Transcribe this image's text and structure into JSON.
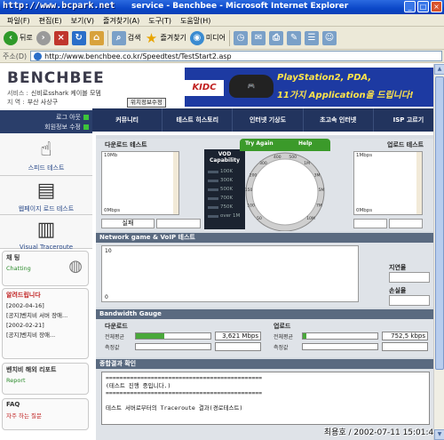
{
  "window": {
    "title_logo": "http://www.bcpark.net",
    "title": "service - Benchbee - Microsoft Internet Explorer",
    "min": "_",
    "max": "□",
    "close": "×"
  },
  "menu": [
    "파일(F)",
    "편집(E)",
    "보기(V)",
    "즐겨찾기(A)",
    "도구(T)",
    "도움말(H)"
  ],
  "toolbar": {
    "back": "뒤로",
    "search": "검색",
    "favorites": "즐겨찾기",
    "media": "미디어"
  },
  "address": {
    "label": "주소(D)",
    "url": "http://www.benchbee.co.kr/Speedtest/TestStart2.asp"
  },
  "header": {
    "logo": "BENCHBEE",
    "service_key": "서비스 :",
    "service_val": "신비로sshark 케이블 모뎀",
    "region_key": "지 역 :",
    "region_val": "부산 사상구",
    "loc_button": "위치정보수정"
  },
  "banner": {
    "kidc": "KIDC",
    "line1": "PlayStation2, PDA,",
    "line2": "11가지 Application을 드립니다!"
  },
  "login": {
    "logout": "로그 아웃",
    "member": "회원정보 수정"
  },
  "side_menu": [
    {
      "label": "스피드 테스트",
      "icon": "hand-pointer-icon"
    },
    {
      "label": "웹페이지 로드 테스트",
      "icon": "document-icon"
    },
    {
      "label": "Visual Traceroute",
      "icon": "graph-icon"
    }
  ],
  "chatting": {
    "title": "채 팅",
    "sub": "Chatting"
  },
  "notice": {
    "title": "알려드립니다",
    "items": [
      {
        "date": "[2002-04-16]",
        "text": "[공지]벤치비 서버 장애..."
      },
      {
        "date": "[2002-02-21]",
        "text": "[공지]벤치비 장애..."
      }
    ]
  },
  "report": {
    "title": "벤치비 해외 리포트",
    "sub": "Report"
  },
  "faq": {
    "title": "FAQ",
    "sub": "자주 하는 질문"
  },
  "nav": [
    "커뮤니티",
    "테스트 히스토리",
    "인터넷 기상도",
    "초고속 인터넷",
    "ISP 고르기"
  ],
  "speed": {
    "download_title": "다운로드 테스트",
    "upload_title": "업로드 테스트",
    "download_top": "10Mb",
    "download_bottom": "0Mbps",
    "upload_top": "1Mbps",
    "upload_bottom": "0Mbps",
    "download_status": "실패",
    "vod_title": "VOD Capability",
    "vod_levels": [
      "100K",
      "300K",
      "500K",
      "700K",
      "750K",
      "over 1M"
    ],
    "try_again": "Try Again",
    "help": "Help",
    "gauge_ticks": [
      "50",
      "100",
      "150",
      "200",
      "300",
      "400",
      "500",
      "1M",
      "3M",
      "5M",
      "7M",
      "10M"
    ]
  },
  "gamevoip": {
    "title": "Network game & VoIP 테스트",
    "axis_top": "10",
    "axis_bottom": "0",
    "latency_label": "지연율",
    "loss_label": "손실율"
  },
  "bandwidth": {
    "title": "Bandwidth Gauge",
    "download": {
      "title": "다운로드",
      "avg_label": "전체평균",
      "measured_label": "측정값",
      "value": "3,621 Mbps",
      "fill": 0.38
    },
    "upload": {
      "title": "업로드",
      "avg_label": "전체평균",
      "measured_label": "측정값",
      "value": "752,5 kbps",
      "fill": 0.05
    }
  },
  "result": {
    "title": "종합결과 확인",
    "lines": [
      "=============================================",
      "(테스트 진행 중입니다.)",
      "=============================================",
      "",
      "테스트 서버로부터의 Traceroute 결과(경로테스트)"
    ]
  },
  "overlay": {
    "text": "최용호 / 2002-07-11 15:01:44"
  },
  "colors": {
    "titlebar": "#0b47c8",
    "nav": "#22345e",
    "accent_green": "#3b9a2a",
    "banner": "#1d3aa2"
  }
}
